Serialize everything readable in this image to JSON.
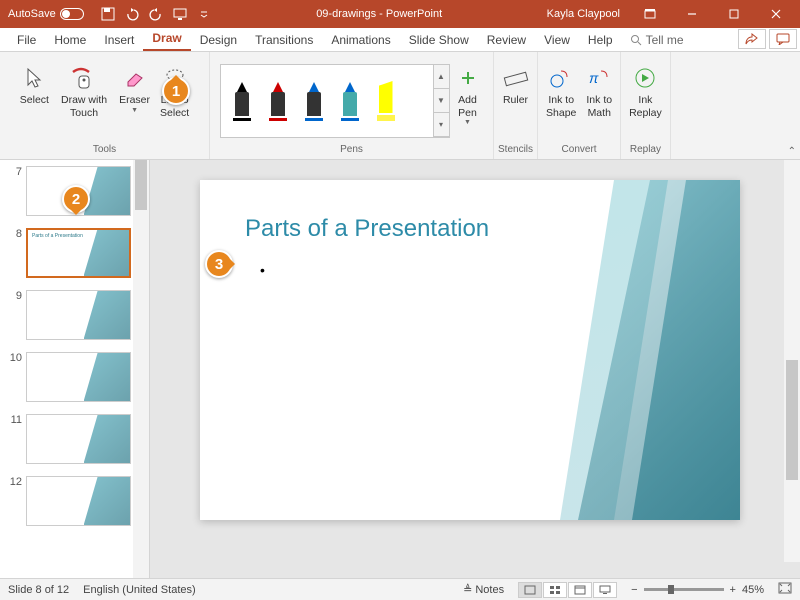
{
  "titlebar": {
    "autosave_label": "AutoSave",
    "doc_title": "09-drawings - PowerPoint",
    "user_name": "Kayla Claypool"
  },
  "tabs": {
    "file": "File",
    "home": "Home",
    "insert": "Insert",
    "draw": "Draw",
    "design": "Design",
    "transitions": "Transitions",
    "animations": "Animations",
    "slideshow": "Slide Show",
    "review": "Review",
    "view": "View",
    "help": "Help",
    "tellme": "Tell me"
  },
  "ribbon": {
    "select": "Select",
    "draw_with_touch": "Draw with\nTouch",
    "eraser": "Eraser",
    "lasso_select": "Lasso\nSelect",
    "add_pen": "Add\nPen",
    "ruler": "Ruler",
    "ink_to_shape": "Ink to\nShape",
    "ink_to_math": "Ink to\nMath",
    "ink_replay": "Ink\nReplay",
    "group_tools": "Tools",
    "group_pens": "Pens",
    "group_stencils": "Stencils",
    "group_convert": "Convert",
    "group_replay": "Replay",
    "pens": [
      {
        "tip": "#000",
        "body": "#333",
        "line": "#000"
      },
      {
        "tip": "#c00",
        "body": "#333",
        "line": "#c00"
      },
      {
        "tip": "#06c",
        "body": "#333",
        "line": "#06c"
      },
      {
        "tip": "#06c",
        "body": "#4aa",
        "line": "#06c"
      },
      {
        "tip": "#ff0",
        "body": "#ff0",
        "line": "rgba(255,240,0,.7)",
        "hl": true
      }
    ]
  },
  "thumbs": [
    {
      "num": "7",
      "txt": ""
    },
    {
      "num": "8",
      "txt": "Parts of a Presentation",
      "active": true
    },
    {
      "num": "9",
      "txt": ""
    },
    {
      "num": "10",
      "txt": ""
    },
    {
      "num": "11",
      "txt": ""
    },
    {
      "num": "12",
      "txt": ""
    }
  ],
  "slide": {
    "title": "Parts of a Presentation",
    "bullet": "•"
  },
  "status": {
    "slide_info": "Slide 8 of 12",
    "lang": "English (United States)",
    "notes": "Notes",
    "zoom": "45%"
  },
  "callouts": {
    "c1": "1",
    "c2": "2",
    "c3": "3"
  }
}
